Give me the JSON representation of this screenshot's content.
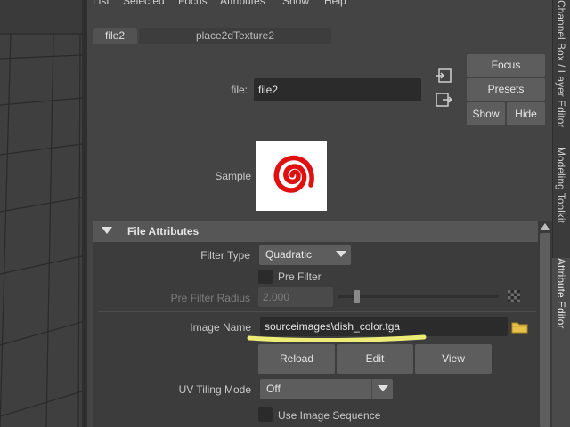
{
  "menu": {
    "items": [
      "List",
      "Selected",
      "Focus",
      "Attributes",
      "Show",
      "Help"
    ]
  },
  "tabs": [
    {
      "label": "file2",
      "active": true
    },
    {
      "label": "place2dTexture2",
      "active": false
    }
  ],
  "file_node": {
    "label": "file:",
    "value": "file2"
  },
  "buttons": {
    "focus": "Focus",
    "presets": "Presets",
    "show": "Show",
    "hide": "Hide"
  },
  "sample": {
    "label": "Sample"
  },
  "section": {
    "title": "File Attributes",
    "expanded": true
  },
  "attributes": {
    "filter_type_label": "Filter Type",
    "filter_type_value": "Quadratic",
    "pre_filter_label": "Pre Filter",
    "pre_filter_radius_label": "Pre Filter Radius",
    "pre_filter_radius_value": "2.000",
    "image_name_label": "Image Name",
    "image_name_value": "sourceimages\\dish_color.tga",
    "reload": "Reload",
    "edit": "Edit",
    "view": "View",
    "uv_tiling_label": "UV Tiling Mode",
    "uv_tiling_value": "Off",
    "use_image_sequence_label": "Use Image Sequence"
  },
  "side_tabs": [
    "Channel Box / Layer Editor",
    "Modeling Toolkit",
    "Attribute Editor"
  ],
  "icons": {
    "load": "load-attributes-icon",
    "copy_tab": "copy-tab-icon",
    "folder": "folder-icon",
    "checker": "checker-icon"
  },
  "colors": {
    "background": "#444444",
    "field": "#2b2b2b",
    "button": "#5d5d5d",
    "highlight": "#f5f57a",
    "sample_red": "#e01010"
  }
}
